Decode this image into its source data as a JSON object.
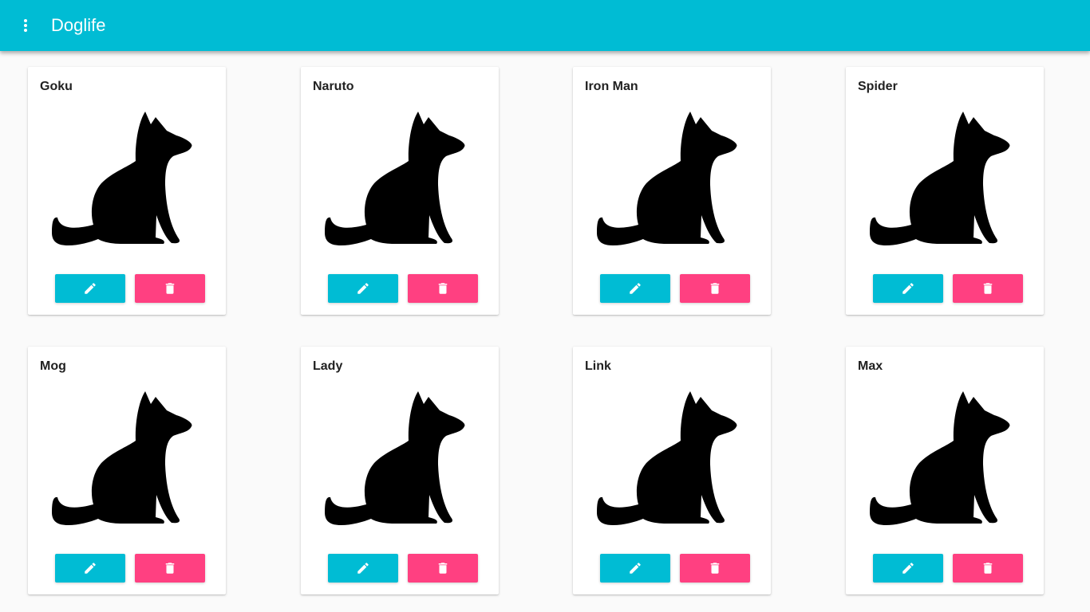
{
  "colors": {
    "primary": "#00bcd4",
    "accent": "#ff4081",
    "card_background": "#ffffff",
    "text": "#212121",
    "icon_fill": "#000000"
  },
  "appbar": {
    "title": "Doglife",
    "menu_icon": "more-vert-icon"
  },
  "dogs": [
    {
      "name": "Goku",
      "image_icon": "sitting-dog-icon",
      "edit_icon": "pencil-icon",
      "delete_icon": "trash-icon"
    },
    {
      "name": "Naruto",
      "image_icon": "sitting-dog-icon",
      "edit_icon": "pencil-icon",
      "delete_icon": "trash-icon"
    },
    {
      "name": "Iron Man",
      "image_icon": "sitting-dog-icon",
      "edit_icon": "pencil-icon",
      "delete_icon": "trash-icon"
    },
    {
      "name": "Spider",
      "image_icon": "sitting-dog-icon",
      "edit_icon": "pencil-icon",
      "delete_icon": "trash-icon"
    },
    {
      "name": "Mog",
      "image_icon": "sitting-dog-icon",
      "edit_icon": "pencil-icon",
      "delete_icon": "trash-icon"
    },
    {
      "name": "Lady",
      "image_icon": "sitting-dog-icon",
      "edit_icon": "pencil-icon",
      "delete_icon": "trash-icon"
    },
    {
      "name": "Link",
      "image_icon": "sitting-dog-icon",
      "edit_icon": "pencil-icon",
      "delete_icon": "trash-icon"
    },
    {
      "name": "Max",
      "image_icon": "sitting-dog-icon",
      "edit_icon": "pencil-icon",
      "delete_icon": "trash-icon"
    }
  ]
}
